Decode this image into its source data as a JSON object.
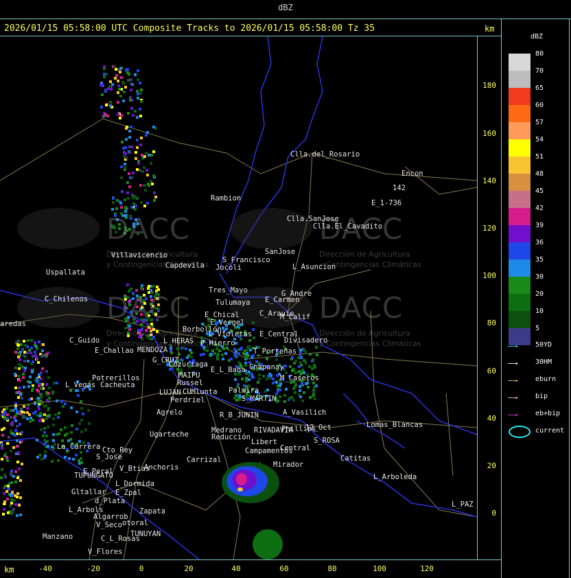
{
  "title": "dBZ",
  "header": "2026/01/15 05:58:00 UTC Composite Tracks to 2026/01/15 05:58:00 Tz 35",
  "axis_unit": "km",
  "y_ticks": [
    "180",
    "160",
    "140",
    "120",
    "100",
    "80",
    "60",
    "40",
    "20",
    "0"
  ],
  "x_ticks": [
    "-40",
    "-20",
    "0",
    "20",
    "40",
    "60",
    "80",
    "100",
    "120"
  ],
  "legend": {
    "title": "dBZ",
    "levels": [
      {
        "label": "80",
        "color": "#d8d8d8"
      },
      {
        "label": "70",
        "color": "#bdbdbd"
      },
      {
        "label": "65",
        "color": "#f23a1e"
      },
      {
        "label": "60",
        "color": "#ff6a14"
      },
      {
        "label": "57",
        "color": "#ff9a5a"
      },
      {
        "label": "54",
        "color": "#ffff00"
      },
      {
        "label": "51",
        "color": "#f8c432"
      },
      {
        "label": "48",
        "color": "#d89040"
      },
      {
        "label": "45",
        "color": "#c8708a"
      },
      {
        "label": "42",
        "color": "#d81c8c"
      },
      {
        "label": "39",
        "color": "#7010cc"
      },
      {
        "label": "36",
        "color": "#1e46e8"
      },
      {
        "label": "35",
        "color": "#1e8ae8"
      },
      {
        "label": "30",
        "color": "#1a8a1a"
      },
      {
        "label": "20",
        "color": "#0e6e12"
      },
      {
        "label": "10",
        "color": "#0c5010"
      },
      {
        "label": "5",
        "color": "#3e3a8a"
      }
    ],
    "tracks": [
      {
        "label": "50YD",
        "color": "#40e0e8"
      },
      {
        "label": "30HM",
        "color": "#ffffff"
      },
      {
        "label": "eburn",
        "color": "#f0c080"
      },
      {
        "label": "bip",
        "color": "#ffc0d8"
      },
      {
        "label": "eb+bip",
        "color": "#e040e0"
      }
    ],
    "current_label": "current",
    "current_color": "#30e8f0"
  },
  "watermark": {
    "name": "DACC",
    "line1": "Dirección de Agricultura",
    "line2": "y Contingencias Climáticas"
  },
  "places": [
    {
      "name": "Clla.del_Rosario"
    },
    {
      "name": "Encon"
    },
    {
      "name": "142"
    },
    {
      "name": "E_1-736"
    },
    {
      "name": "Rambion"
    },
    {
      "name": "Clla.SanJose"
    },
    {
      "name": "Clla.El_Cavadito"
    },
    {
      "name": "Villavicencio"
    },
    {
      "name": "S_Francisco"
    },
    {
      "name": "SanJose"
    },
    {
      "name": "L_Asuncion"
    },
    {
      "name": "Capdevila"
    },
    {
      "name": "Uspallata"
    },
    {
      "name": "Jocoli"
    },
    {
      "name": "Tres_Mayo"
    },
    {
      "name": "G_Andre"
    },
    {
      "name": "C_Chilenos"
    },
    {
      "name": "Tulumaya"
    },
    {
      "name": "E_Carmen"
    },
    {
      "name": "C_Arauio"
    },
    {
      "name": "M_Calif"
    },
    {
      "name": "E_Chical"
    },
    {
      "name": "E_Vergel"
    },
    {
      "name": "Borbollon"
    },
    {
      "name": "L_Violetas"
    },
    {
      "name": "E_Central"
    },
    {
      "name": "Divisadero"
    },
    {
      "name": "aredas"
    },
    {
      "name": "C_Guido"
    },
    {
      "name": "L_HERAS"
    },
    {
      "name": "P_Hierro"
    },
    {
      "name": "T_Porteñas"
    },
    {
      "name": "E_Challao"
    },
    {
      "name": "MENDOZA"
    },
    {
      "name": "G_CRUZ"
    },
    {
      "name": "Luzuriaga"
    },
    {
      "name": "Chapanay"
    },
    {
      "name": "E_L_Baña"
    },
    {
      "name": "M_Caseros"
    },
    {
      "name": "MAIPU"
    },
    {
      "name": "Potrerillos"
    },
    {
      "name": "L_Vegas"
    },
    {
      "name": "Cacheuta"
    },
    {
      "name": "Russel"
    },
    {
      "name": "LUJAN"
    },
    {
      "name": "CUMlunta"
    },
    {
      "name": "Palmira"
    },
    {
      "name": "S_MARTIN"
    },
    {
      "name": "Perdriel"
    },
    {
      "name": "A_Vasilich"
    },
    {
      "name": "Agrelo"
    },
    {
      "name": "R_B_JUNIN"
    },
    {
      "name": "Medrano"
    },
    {
      "name": "RIVADAVIA"
    },
    {
      "name": "Phillips"
    },
    {
      "name": "12_Oct"
    },
    {
      "name": "Ugarteche"
    },
    {
      "name": "Reducción"
    },
    {
      "name": "Libert"
    },
    {
      "name": "S_ROSA"
    },
    {
      "name": "Lomas_Blancas"
    },
    {
      "name": "La_Carrera"
    },
    {
      "name": "Cto_Rey"
    },
    {
      "name": "S_Jose"
    },
    {
      "name": "Campamentos"
    },
    {
      "name": "Central"
    },
    {
      "name": "Catitas"
    },
    {
      "name": "Carrizal"
    },
    {
      "name": "Mirador"
    },
    {
      "name": "V_Btias"
    },
    {
      "name": "Anchoris"
    },
    {
      "name": "E_Peral"
    },
    {
      "name": "TUPUNGATO"
    },
    {
      "name": "L_Dormida"
    },
    {
      "name": "L_Arboleda"
    },
    {
      "name": "Gltallar"
    },
    {
      "name": "E_Zpal"
    },
    {
      "name": "d_Plata"
    },
    {
      "name": "L_Arbols"
    },
    {
      "name": "Zapata"
    },
    {
      "name": "Algarrob"
    },
    {
      "name": "V_Seco"
    },
    {
      "name": "otoral"
    },
    {
      "name": "TUNUYAN"
    },
    {
      "name": "Manzano"
    },
    {
      "name": "C_L_Rosas"
    },
    {
      "name": "V_Flores"
    },
    {
      "name": "L_PAZ"
    }
  ]
}
